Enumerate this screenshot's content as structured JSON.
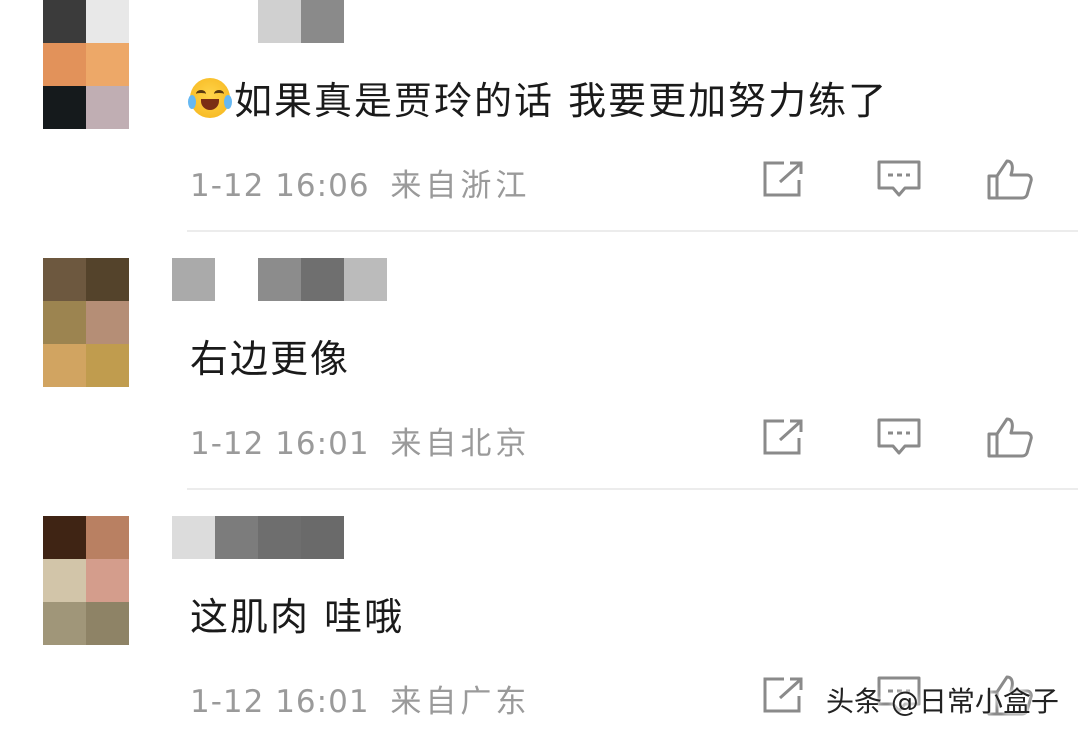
{
  "comments": [
    {
      "username": "",
      "text": "如果真是贾玲的话 我要更加努力练了",
      "emoji": "laughing-crying-emoji",
      "date_time": "1-12 16:06",
      "location": "来自浙江",
      "avatar_colors": [
        "#3b3b3b",
        "#e8e8e8",
        "#e2925a",
        "#eda868",
        "#151a1c",
        "#c0aeb3"
      ],
      "username_colors": [
        "#ffffff",
        "#ffffff",
        "#d0d0d0",
        "#8a8a8a"
      ]
    },
    {
      "username": "",
      "text": "右边更像",
      "date_time": "1-12 16:01",
      "location": "来自北京",
      "avatar_colors": [
        "#6d583f",
        "#54432b",
        "#9c8450",
        "#b58e76",
        "#d1a461",
        "#c09c4e"
      ],
      "username_colors": [
        "#aaaaaa",
        "#ffffff",
        "#8c8c8c",
        "#6f6f6f",
        "#bbbbbb"
      ]
    },
    {
      "username": "",
      "text": "这肌肉 哇哦",
      "date_time": "1-12 16:01",
      "location": "来自广东",
      "avatar_colors": [
        "#3f2414",
        "#b98062",
        "#d2c5a9",
        "#d49d8c",
        "#a09679",
        "#8e8366"
      ],
      "username_colors": [
        "#dcdcdc",
        "#7c7c7c",
        "#6e6e6e",
        "#6a6a6a"
      ]
    }
  ],
  "actions": {
    "share": "share-icon",
    "reply": "comment-icon",
    "like": "thumbs-up-icon"
  },
  "colors": {
    "text": "#1a1a1a",
    "meta": "#9a9a9a",
    "icon": "#8a8a8a",
    "divider": "#ececec"
  },
  "watermark": "头条 @日常小盒子"
}
